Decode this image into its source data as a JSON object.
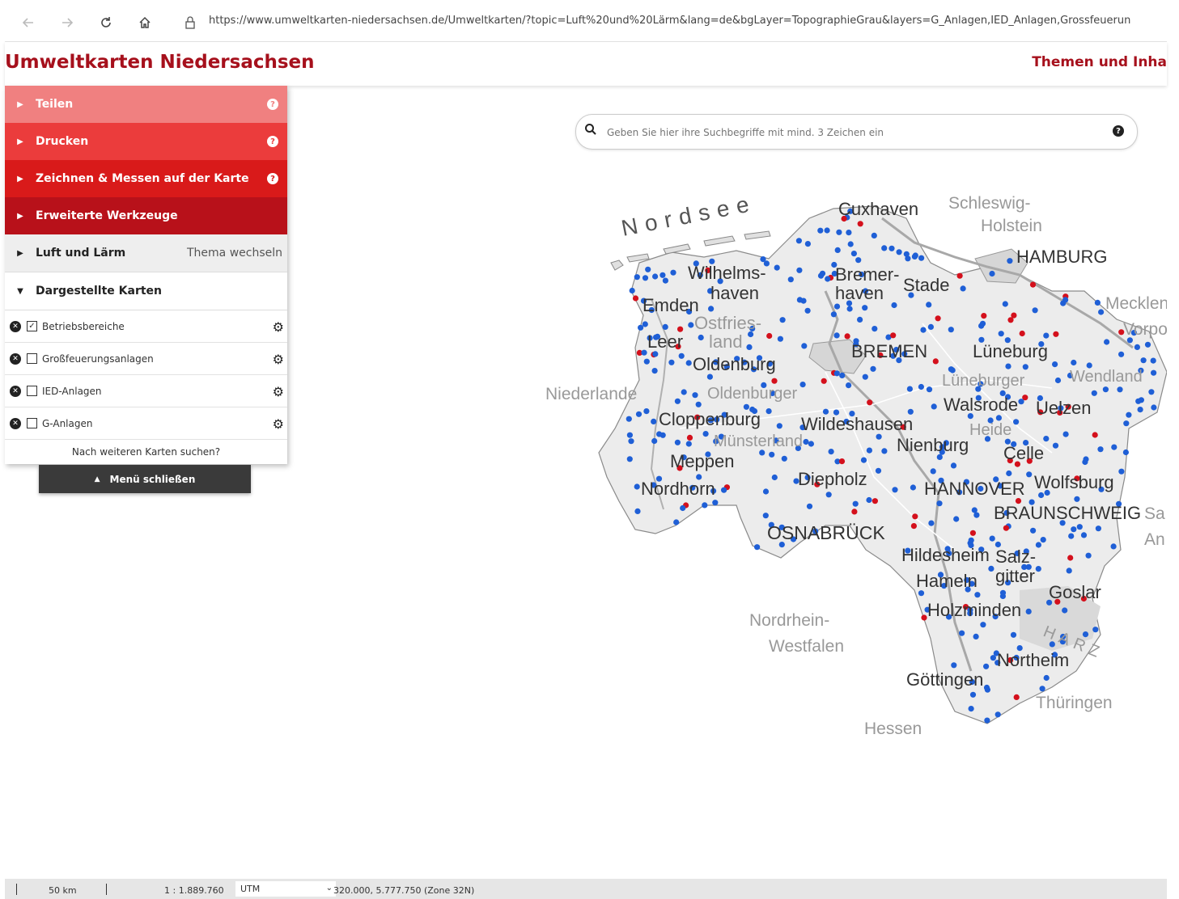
{
  "browser": {
    "url": "https://www.umweltkarten-niedersachsen.de/Umweltkarten/?topic=Luft%20und%20Lärm&lang=de&bgLayer=TopographieGrau&layers=G_Anlagen,IED_Anlagen,Grossfeuerun"
  },
  "header": {
    "title": "Umweltkarten Niedersachsen",
    "themen_link": "Themen und Inha"
  },
  "menu": {
    "tools": [
      {
        "label": "Teilen",
        "color": "#f08080",
        "help": true
      },
      {
        "label": "Drucken",
        "color": "#eb3c3c",
        "help": true
      },
      {
        "label": "Zeichnen & Messen auf der Karte",
        "color": "#d91a1a",
        "help": true
      },
      {
        "label": "Erweiterte Werkzeuge",
        "color": "#b8111a",
        "help": false
      }
    ],
    "topic": {
      "label": "Luft und Lärm",
      "switch_label": "Thema wechseln"
    },
    "shown_maps": {
      "label": "Dargestellte Karten",
      "layers": [
        {
          "label": "Betriebsbereiche",
          "checked": true
        },
        {
          "label": "Großfeuerungsanlagen",
          "checked": false
        },
        {
          "label": "IED-Anlagen",
          "checked": false
        },
        {
          "label": "G-Anlagen",
          "checked": false
        }
      ]
    },
    "more_maps": "Nach weiteren Karten suchen?",
    "close_label": "Menü schließen"
  },
  "search": {
    "placeholder": "Geben Sie hier ihre Suchbegriffe mit mind. 3 Zeichen ein"
  },
  "map": {
    "labels": {
      "nordsee": "Nordsee",
      "cuxhaven": "Cuxhaven",
      "schleswig_1": "Schleswig-",
      "schleswig_2": "Holstein",
      "hamburg": "HAMBURG",
      "wilhelms_1": "Wilhelms-",
      "wilhelms_2": "haven",
      "bremer_1": "Bremer-",
      "bremer_2": "haven",
      "stade": "Stade",
      "mecklen": "Mecklen",
      "vorpo": "Vorpo",
      "emden": "Emden",
      "ostfries_1": "Ostfries-",
      "ostfries_2": "land",
      "leer": "Leer",
      "bremen": "BREMEN",
      "lueneburg": "Lüneburg",
      "oldenburg": "Oldenburg",
      "oldenburger": "Oldenburger",
      "lueneburger": "Lüneburger",
      "wendland": "Wendland",
      "niederlande": "Niederlande",
      "walsrode": "Walsrode",
      "uelzen": "Uelzen",
      "cloppenburg": "Cloppenburg",
      "wildeshausen": "Wildeshausen",
      "heide": "Heide",
      "muensterland": "Münsterland",
      "nienburg": "Nienburg",
      "celle": "Celle",
      "meppen": "Meppen",
      "nordhorn": "Nordhorn",
      "diepholz": "Diepholz",
      "hannover": "HANNOVER",
      "wolfsburg": "Wolfsburg",
      "braunschweig": "BRAUNSCHWEIG",
      "sa": "Sa",
      "an": "An",
      "osnabrueck": "OSNABRÜCK",
      "hildesheim": "Hildesheim",
      "salz_1": "Salz-",
      "salz_2": "gitter",
      "hameln": "Hameln",
      "goslar": "Goslar",
      "holzminden": "Holzminden",
      "nrw_1": "Nordrhein-",
      "nrw_2": "Westfalen",
      "harz": "HARZ",
      "northeim": "Northeim",
      "goettingen": "Göttingen",
      "thueringen": "Thüringen",
      "hessen": "Hessen"
    },
    "marker_colors": {
      "blue": "#1f5fd6",
      "red": "#d4101c"
    }
  },
  "statusbar": {
    "scale_bar": "50 km",
    "scale": "1 : 1.889.760",
    "projection": "UTM",
    "coords": "320.000, 5.777.750 (Zone 32N)"
  }
}
